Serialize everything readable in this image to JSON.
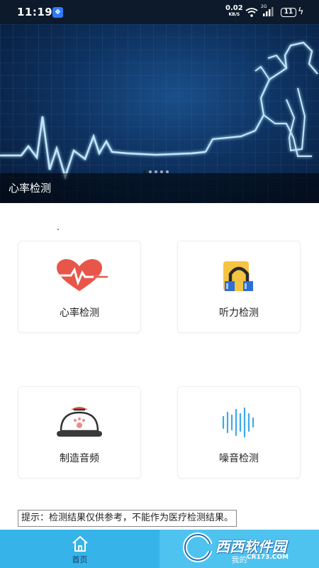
{
  "status_bar": {
    "time": "11:19",
    "net_speed": "0.02",
    "net_unit": "KB/S",
    "signal_label": "2G",
    "battery": "11"
  },
  "banner": {
    "caption": "心率检测",
    "slide_count": 5,
    "active_slide": 1
  },
  "features": [
    {
      "label": "心率检测",
      "icon": "heart-pulse-icon"
    },
    {
      "label": "听力检测",
      "icon": "headphones-icon"
    },
    {
      "label": "制造音频",
      "icon": "bell-cloche-icon"
    },
    {
      "label": "噪音检测",
      "icon": "sound-wave-icon"
    }
  ],
  "notice": "提示：检测结果仅供参考，不能作为医疗检测结果。",
  "bottom_nav": {
    "home_label": "首页",
    "mine_label": "我的"
  },
  "watermark": {
    "text": "西西软件园",
    "sub": "CR173.COM"
  },
  "colors": {
    "nav_bg": "#35b6ea",
    "heart": "#e8564a",
    "wave": "#3fa9e8"
  }
}
